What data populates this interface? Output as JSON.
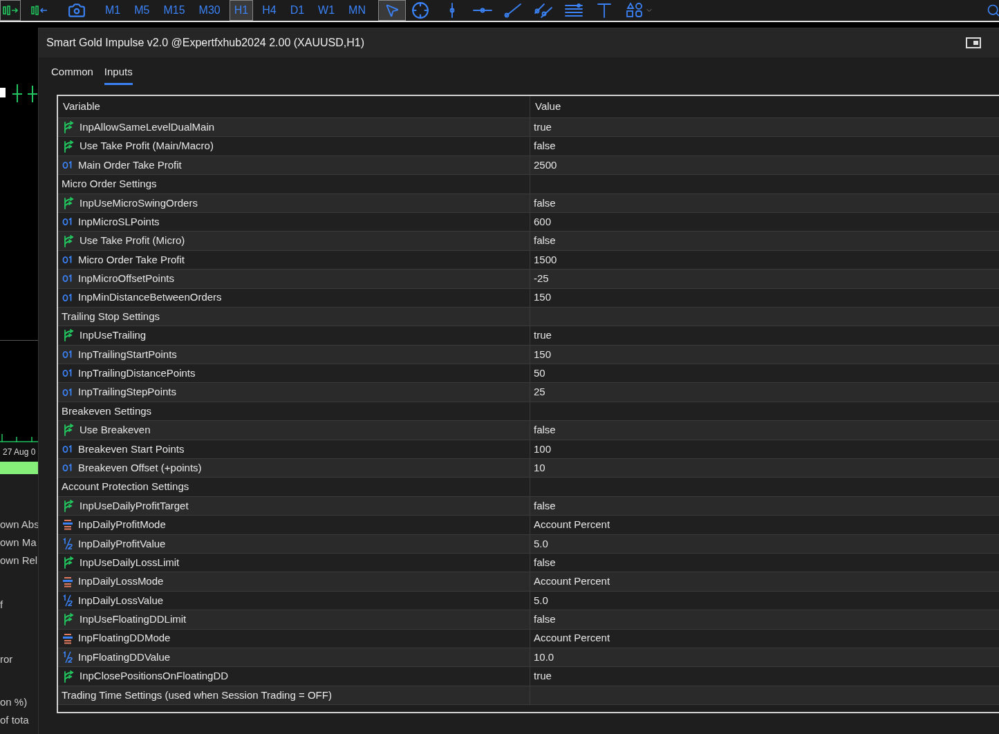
{
  "toolbar": {
    "timeframes": [
      {
        "label": "M1",
        "selected": false
      },
      {
        "label": "M5",
        "selected": false
      },
      {
        "label": "M15",
        "selected": false
      },
      {
        "label": "M30",
        "selected": false
      },
      {
        "label": "H1",
        "selected": true
      },
      {
        "label": "H4",
        "selected": false
      },
      {
        "label": "D1",
        "selected": false
      },
      {
        "label": "W1",
        "selected": false
      },
      {
        "label": "MN",
        "selected": false
      }
    ]
  },
  "background_panel": {
    "date_label": "27 Aug 0",
    "lines": [
      "own Abs",
      "own Ma",
      "own Rel",
      "f",
      "ror",
      "on %)",
      "of tota"
    ]
  },
  "dialog": {
    "title": "Smart Gold Impulse v2.0 @Expertfxhub2024 2.00 (XAUUSD,H1)",
    "tabs": [
      {
        "label": "Common",
        "selected": false
      },
      {
        "label": "Inputs",
        "selected": true
      }
    ],
    "table": {
      "columns": [
        "Variable",
        "Value"
      ],
      "rows": [
        {
          "kind": "bool",
          "name": "InpAllowSameLevelDualMain",
          "value": "true"
        },
        {
          "kind": "bool",
          "name": "Use Take Profit (Main/Macro)",
          "value": "false"
        },
        {
          "kind": "int",
          "name": "Main Order Take Profit",
          "value": "2500"
        },
        {
          "kind": "group",
          "name": "Micro Order Settings"
        },
        {
          "kind": "bool",
          "name": "InpUseMicroSwingOrders",
          "value": "false"
        },
        {
          "kind": "int",
          "name": "InpMicroSLPoints",
          "value": "600"
        },
        {
          "kind": "bool",
          "name": "Use Take Profit (Micro)",
          "value": "false"
        },
        {
          "kind": "int",
          "name": "Micro Order Take Profit",
          "value": "1500"
        },
        {
          "kind": "int",
          "name": "InpMicroOffsetPoints",
          "value": "-25"
        },
        {
          "kind": "int",
          "name": "InpMinDistanceBetweenOrders",
          "value": "150"
        },
        {
          "kind": "group",
          "name": "Trailing Stop Settings"
        },
        {
          "kind": "bool",
          "name": "InpUseTrailing",
          "value": "true"
        },
        {
          "kind": "int",
          "name": "InpTrailingStartPoints",
          "value": "150"
        },
        {
          "kind": "int",
          "name": "InpTrailingDistancePoints",
          "value": "50"
        },
        {
          "kind": "int",
          "name": "InpTrailingStepPoints",
          "value": "25"
        },
        {
          "kind": "group",
          "name": "Breakeven Settings"
        },
        {
          "kind": "bool",
          "name": "Use Breakeven",
          "value": "false"
        },
        {
          "kind": "int",
          "name": "Breakeven Start Points",
          "value": "100"
        },
        {
          "kind": "int",
          "name": "Breakeven Offset (+points)",
          "value": "10"
        },
        {
          "kind": "group",
          "name": "Account Protection Settings"
        },
        {
          "kind": "bool",
          "name": "InpUseDailyProfitTarget",
          "value": "false"
        },
        {
          "kind": "enum",
          "name": "InpDailyProfitMode",
          "value": "Account Percent"
        },
        {
          "kind": "double",
          "name": "InpDailyProfitValue",
          "value": "5.0"
        },
        {
          "kind": "bool",
          "name": "InpUseDailyLossLimit",
          "value": "false"
        },
        {
          "kind": "enum",
          "name": "InpDailyLossMode",
          "value": "Account Percent"
        },
        {
          "kind": "double",
          "name": "InpDailyLossValue",
          "value": "5.0"
        },
        {
          "kind": "bool",
          "name": "InpUseFloatingDDLimit",
          "value": "false"
        },
        {
          "kind": "enum",
          "name": "InpFloatingDDMode",
          "value": "Account Percent"
        },
        {
          "kind": "double",
          "name": "InpFloatingDDValue",
          "value": "10.0"
        },
        {
          "kind": "bool",
          "name": "InpClosePositionsOnFloatingDD",
          "value": "true"
        },
        {
          "kind": "group",
          "name": "Trading Time Settings (used when Session Trading = OFF)"
        }
      ]
    }
  }
}
